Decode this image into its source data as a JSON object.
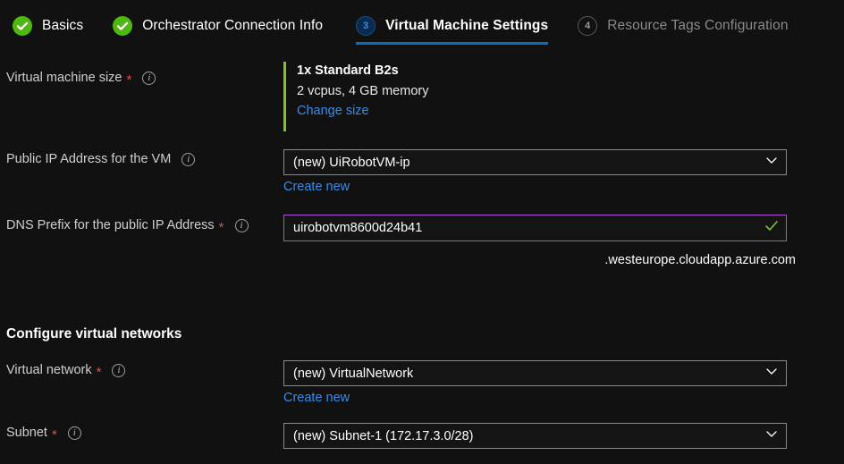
{
  "wizard": {
    "tabs": [
      {
        "label": "Basics",
        "state": "done",
        "badge_icon": "check-icon",
        "number": ""
      },
      {
        "label": "Orchestrator Connection Info",
        "state": "done",
        "badge_icon": "check-icon",
        "number": ""
      },
      {
        "label": "Virtual Machine Settings",
        "state": "current",
        "badge_icon": "step-number",
        "number": "3"
      },
      {
        "label": "Resource Tags Configuration",
        "state": "future",
        "badge_icon": "step-number",
        "number": "4"
      }
    ]
  },
  "form": {
    "vm_size": {
      "label": "Virtual machine size",
      "required_marker": "*",
      "info_icon": "info-icon",
      "title": "1x Standard B2s",
      "subtitle": "2 vcpus, 4 GB memory",
      "change_link": "Change size"
    },
    "public_ip": {
      "label": "Public IP Address for the VM",
      "info_icon": "info-icon",
      "value": "(new) UiRobotVM-ip",
      "chevron_icon": "chevron-down-icon",
      "create_link": "Create new"
    },
    "dns_prefix": {
      "label": "DNS Prefix for the public IP Address",
      "required_marker": "*",
      "info_icon": "info-icon",
      "value": "uirobotvm8600d24b41",
      "placeholder": "",
      "valid_icon": "check-icon",
      "suffix": ".westeurope.cloudapp.azure.com"
    },
    "networks_section_title": "Configure virtual networks",
    "virtual_network": {
      "label": "Virtual network",
      "required_marker": "*",
      "info_icon": "info-icon",
      "value": "(new) VirtualNetwork",
      "chevron_icon": "chevron-down-icon",
      "create_link": "Create new"
    },
    "subnet": {
      "label": "Subnet",
      "required_marker": "*",
      "info_icon": "info-icon",
      "value": "(new) Subnet-1 (172.17.3.0/28)",
      "chevron_icon": "chevron-down-icon"
    }
  },
  "colors": {
    "background": "#111111",
    "accent_blue": "#0f6cbd",
    "link_blue": "#3b8ce8",
    "success_green": "#4fb810",
    "vm_accent_green": "#84c224",
    "focus_purple": "#b14fd8",
    "required_red": "#e04e4e"
  }
}
